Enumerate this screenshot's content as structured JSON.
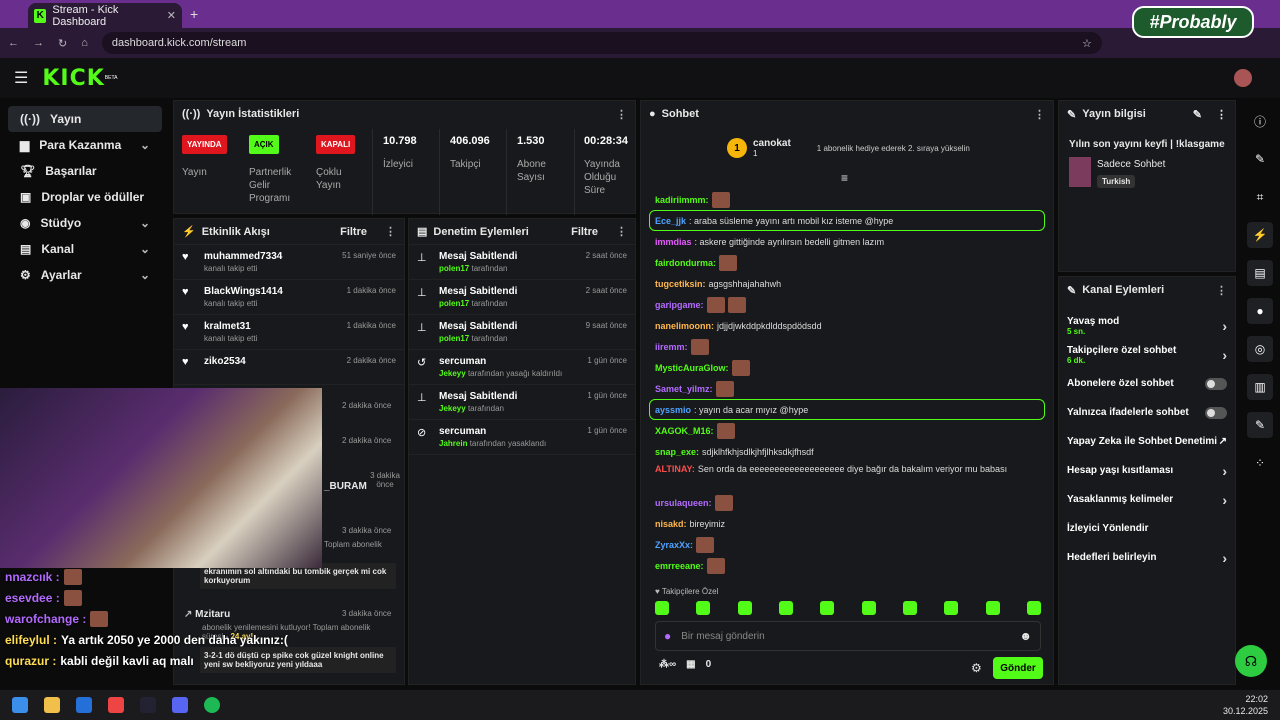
{
  "browser": {
    "tab_title": "Stream - Kick Dashboard",
    "url": "dashboard.kick.com/stream",
    "watermark": "#Probably"
  },
  "topbar": {
    "logo": "KICK",
    "logo_sup": "BETA"
  },
  "sidebar": {
    "items": [
      {
        "label": "Yayın",
        "icon": "broadcast-icon"
      },
      {
        "label": "Para Kazanma",
        "icon": "money-icon"
      },
      {
        "label": "Başarılar",
        "icon": "trophy-icon"
      },
      {
        "label": "Droplar ve ödüller",
        "icon": "gift-icon"
      },
      {
        "label": "Stüdyo",
        "icon": "studio-icon"
      },
      {
        "label": "Kanal",
        "icon": "channel-icon"
      },
      {
        "label": "Ayarlar",
        "icon": "gear-icon"
      }
    ]
  },
  "stats": {
    "title": "Yayın İstatistikleri",
    "yayin_badge": "YAYINDA",
    "yayin_label": "Yayın",
    "partner_badge": "AÇIK",
    "partner_label": "Partnerlik Gelir Programı",
    "coklu_badge": "KAPALI",
    "coklu_label": "Çoklu Yayın",
    "viewers": "10.798",
    "viewers_label": "İzleyici",
    "followers": "406.096",
    "followers_label": "Takipçi",
    "subs": "1.530",
    "subs_label": "Abone Sayısı",
    "uptime": "00:28:34",
    "uptime_label": "Yayında Olduğu Süre"
  },
  "activity": {
    "title": "Etkinlik Akışı",
    "filter": "Filtre",
    "events": [
      {
        "name": "muhammed7334",
        "sub": "kanalı takip etti",
        "time": "51 saniye önce"
      },
      {
        "name": "BlackWings1414",
        "sub": "kanalı takip etti",
        "time": "1 dakika önce"
      },
      {
        "name": "kralmet31",
        "sub": "kanalı takip etti",
        "time": "1 dakika önce"
      },
      {
        "name": "ziko2534",
        "sub": "kanalı takip etti",
        "time": "2 dakika önce"
      }
    ],
    "partial": [
      "2 dakika önce",
      "2 dakika önce",
      "_BURAM",
      "3 dakika önce",
      "3 dakika önce",
      "Toplam abonelik"
    ],
    "msg1": "ekranımın sol altındaki bu tombik gerçek mi cok korkuyorum",
    "mz_name": "Mzitaru",
    "mz_time": "3 dakika önce",
    "mz_sub": "abonelik yenilemesini kutluyor! Toplam abonelik süresi -",
    "mz_months": "24 ay!",
    "msg2": "3-2-1 dö düştü cp spike cok güzel knight online yeni sw bekliyoruz yeni yıldaaa"
  },
  "moderation": {
    "title": "Denetim Eylemleri",
    "filter": "Filtre",
    "items": [
      {
        "title": "Mesaj Sabitlendi",
        "user": "polen17",
        "suffix": "tarafından",
        "time": "2 saat önce",
        "icon": "pin-icon"
      },
      {
        "title": "Mesaj Sabitlendi",
        "user": "polen17",
        "suffix": "tarafından",
        "time": "2 saat önce",
        "icon": "pin-icon"
      },
      {
        "title": "Mesaj Sabitlendi",
        "user": "polen17",
        "suffix": "tarafından",
        "time": "9 saat önce",
        "icon": "pin-icon"
      },
      {
        "title": "sercuman",
        "user": "Jekeyy",
        "suffix": "tarafından yasağı kaldırıldı",
        "time": "1 gün önce",
        "icon": "undo-icon"
      },
      {
        "title": "Mesaj Sabitlendi",
        "user": "Jekeyy",
        "suffix": "tarafından",
        "time": "1 gün önce",
        "icon": "pin-icon"
      },
      {
        "title": "sercuman",
        "user": "Jahrein",
        "suffix": "tarafından yasaklandı",
        "time": "1 gün önce",
        "icon": "ban-icon"
      }
    ]
  },
  "chat": {
    "title": "Sohbet",
    "top_user": "canokat",
    "top_rank": "1",
    "top_count": "1",
    "top_msg": "1 abonelik hediye ederek 2. sıraya yükselin",
    "lines": [
      {
        "user": "kadiriimmm:",
        "color": "#53fc18",
        "text": "",
        "emotes": 1
      },
      {
        "user": "Ece_jjk",
        "color": "#4fa3ff",
        "text": ": araba süsleme yayını artı mobil kız isteme @hype",
        "hl": true
      },
      {
        "user": "immdias",
        "color": "#e85aff",
        "text": ": askere gittiğinde ayrılırsın bedelli gitmen lazım"
      },
      {
        "user": "fairdondurma:",
        "color": "#53fc18",
        "text": "",
        "emotes": 1
      },
      {
        "user": "tugcetiksin:",
        "color": "#ffb84d",
        "text": " agsgshhajahahwh"
      },
      {
        "user": "garipgame:",
        "color": "#b36bff",
        "text": "",
        "emotes": 2
      },
      {
        "user": "nanelimoonn:",
        "color": "#ffb84d",
        "text": " jdjjdjwkddpkdlddspdödsdd"
      },
      {
        "user": "iiremm:",
        "color": "#b36bff",
        "text": "",
        "emotes": 1
      },
      {
        "user": "MysticAuraGlow:",
        "color": "#53fc18",
        "text": "",
        "emotes": 1
      },
      {
        "user": "Samet_yilmz:",
        "color": "#b36bff",
        "text": "",
        "emotes": 1
      },
      {
        "user": "ayssmio",
        "color": "#4fa3ff",
        "text": ": yayın da acar mıyız @hype",
        "hl": true
      },
      {
        "user": "XAGOK_M16:",
        "color": "#53fc18",
        "text": "",
        "emotes": 1
      },
      {
        "user": "snap_exe:",
        "color": "#53fc18",
        "text": " sdjklhfkhjsdlkjhfjlhksdkjfhsdf"
      },
      {
        "user": "ALTINAY:",
        "color": "#ff4d4d",
        "text": " Sen orda da eeeeeeeeeeeeeeeeeee diye bağır da bakalım veriyor mu babası"
      },
      {
        "user": "ursulaqueen:",
        "color": "#b36bff",
        "text": "",
        "emotes": 1
      },
      {
        "user": "nisakd:",
        "color": "#ffb84d",
        "text": " bireyimiz"
      },
      {
        "user": "ZyraxXx:",
        "color": "#4fa3ff",
        "text": "",
        "emotes": 1
      },
      {
        "user": "emrreeane:",
        "color": "#53fc18",
        "text": "",
        "emotes": 1
      }
    ],
    "mode": "Takipçilere Özel",
    "placeholder": "Bir mesaj gönderin",
    "points": "0",
    "send": "Gönder"
  },
  "info": {
    "title": "Yayın bilgisi",
    "stream_title": "Yılın son yayını keyfi | !klasgame",
    "category": "Sadece Sohbet",
    "lang": "Turkish"
  },
  "channel_actions": {
    "title": "Kanal Eylemleri",
    "items": [
      {
        "label": "Yavaş mod",
        "sub": "5 sn.",
        "kind": "arrow"
      },
      {
        "label": "Takipçilere özel sohbet",
        "sub": "6 dk.",
        "kind": "arrow"
      },
      {
        "label": "Abonelere özel sohbet",
        "kind": "toggle"
      },
      {
        "label": "Yalnızca ifadelerle sohbet",
        "kind": "toggle"
      },
      {
        "label": "Yapay Zeka ile Sohbet Denetimi",
        "kind": "ext"
      },
      {
        "label": "Hesap yaşı kısıtlaması",
        "kind": "arrow"
      },
      {
        "label": "Yasaklanmış kelimeler",
        "kind": "arrow"
      },
      {
        "label": "İzleyici Yönlendir",
        "kind": "none"
      },
      {
        "label": "Hedefleri belirleyin",
        "kind": "arrow"
      }
    ]
  },
  "overlay": {
    "lines": [
      {
        "user": "nnazcıık :",
        "color": "#b36bff",
        "text": ""
      },
      {
        "user": "esevdee :",
        "color": "#b36bff",
        "text": ""
      },
      {
        "user": "warofchange :",
        "color": "#b36bff",
        "text": ""
      },
      {
        "user": "elifeylul :",
        "color": "#ffdd55",
        "text": " Ya artık 2050 ye 2000 den daha yakınız:("
      },
      {
        "user": "qurazur :",
        "color": "#ffdd55",
        "text": " kabli değil kavli aq malı"
      }
    ]
  },
  "clock": {
    "time": "22:02",
    "date": "30.12.2025"
  }
}
